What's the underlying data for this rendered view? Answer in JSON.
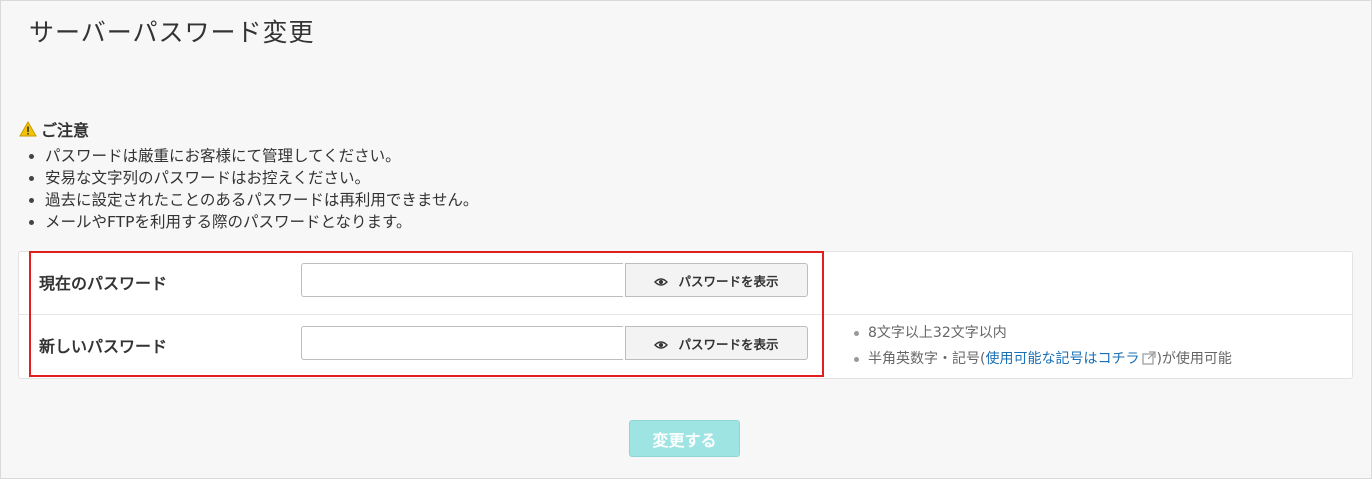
{
  "page": {
    "title": "サーバーパスワード変更"
  },
  "notice": {
    "heading": "ご注意",
    "items": [
      "パスワードは厳重にお客様にて管理してください。",
      "安易な文字列のパスワードはお控えください。",
      "過去に設定されたことのあるパスワードは再利用できません。",
      "メールやFTPを利用する際のパスワードとなります。"
    ]
  },
  "form": {
    "current": {
      "label": "現在のパスワード",
      "value": "",
      "show_label": "パスワードを表示"
    },
    "new": {
      "label": "新しいパスワード",
      "value": "",
      "show_label": "パスワードを表示"
    },
    "hints": {
      "length": "8文字以上32文字以内",
      "chars_prefix": "半角英数字・記号(",
      "chars_link": "使用可能な記号はコチラ",
      "chars_suffix": ")が使用可能"
    },
    "submit_label": "変更する"
  },
  "colors": {
    "highlight": "#e01f1f",
    "link": "#1a6fb5",
    "submit_bg": "#9ee4e3",
    "warning": "#f5c400"
  },
  "icons": {
    "warning": "warning-icon",
    "eye": "eye-icon",
    "external": "external-link-icon"
  }
}
